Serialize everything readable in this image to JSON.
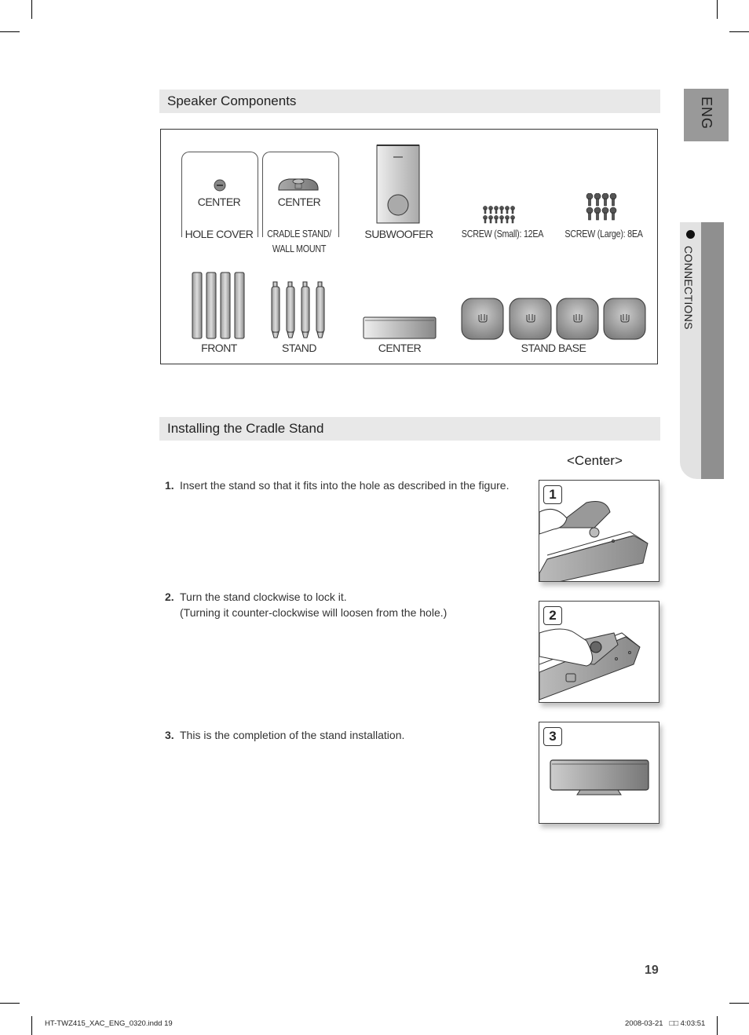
{
  "side_tabs": {
    "language": "ENG",
    "chapter": "CONNECTIONS"
  },
  "speaker_components": {
    "title": "Speaker Components",
    "items": [
      {
        "top": "CENTER",
        "bottom": "HOLE COVER",
        "icon": "hole-cover-icon"
      },
      {
        "top": "CENTER",
        "bottom": "CRADLE STAND/",
        "bottom2": "WALL MOUNT",
        "icon": "cradle-stand-icon"
      },
      {
        "bottom": "SUBWOOFER",
        "icon": "subwoofer-icon"
      },
      {
        "bottom": "SCREW (Small): 12EA",
        "icon": "small-screws-icon"
      },
      {
        "bottom": "SCREW (Large): 8EA",
        "icon": "large-screws-icon"
      },
      {
        "bottom": "FRONT",
        "icon": "front-speakers-icon"
      },
      {
        "bottom": "STAND",
        "icon": "stand-poles-icon"
      },
      {
        "bottom": "CENTER",
        "icon": "center-speaker-icon"
      },
      {
        "bottom": "STAND BASE",
        "icon": "stand-base-icon"
      }
    ]
  },
  "cradle_stand": {
    "title": "Installing the Cradle Stand",
    "figure_caption": "<Center>",
    "steps": [
      {
        "num": "1.",
        "text": "Insert the stand so that it fits into the hole as described in the figure.",
        "figure_num": "1"
      },
      {
        "num": "2.",
        "text": "Turn the stand clockwise to lock it.",
        "text2": "(Turning it counter-clockwise will loosen from the hole.)",
        "figure_num": "2"
      },
      {
        "num": "3.",
        "text": "This is the completion of the stand installation.",
        "figure_num": "3"
      }
    ]
  },
  "page_number": "19",
  "footer": {
    "file": "HT-TWZ415_XAC_ENG_0320.indd   19",
    "timestamp": "2008-03-21   □□ 4:03:51"
  }
}
